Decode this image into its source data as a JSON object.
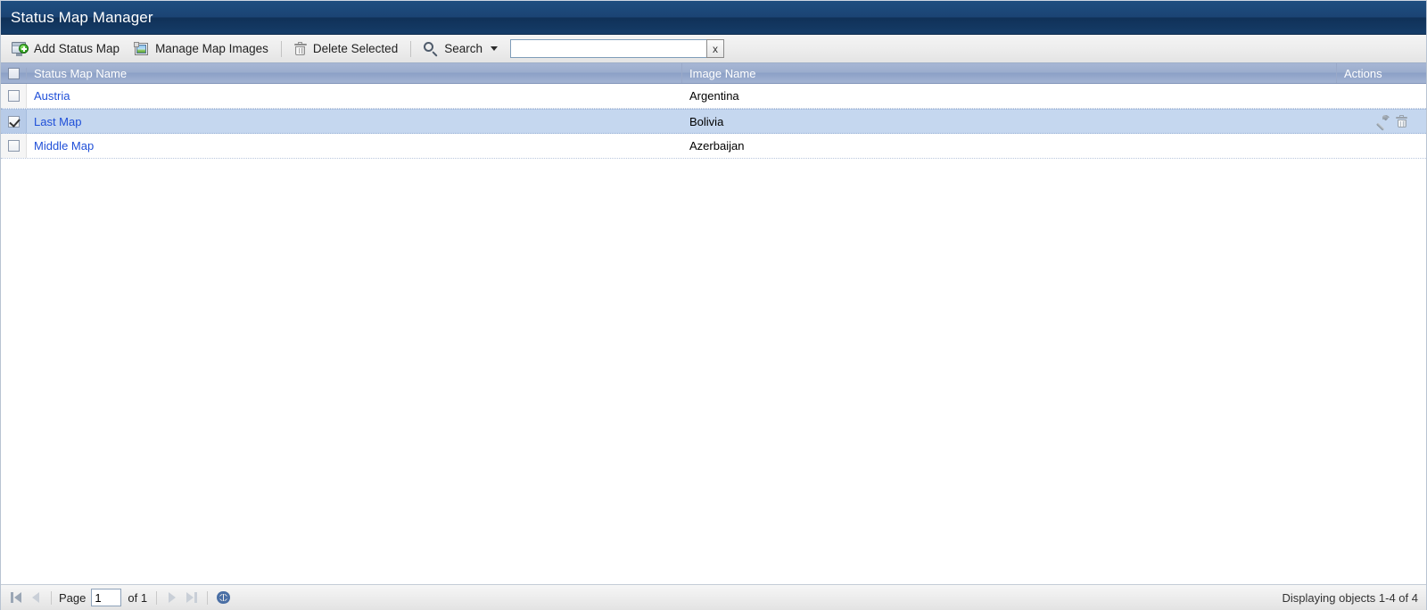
{
  "window": {
    "title": "Status Map Manager"
  },
  "toolbar": {
    "add_status_map": "Add Status Map",
    "manage_map_images": "Manage Map Images",
    "delete_selected": "Delete Selected",
    "search_label": "Search",
    "search_value": "",
    "search_placeholder": "",
    "search_clear_label": "x",
    "icons": {
      "add": "add-status-map-icon",
      "images": "manage-map-images-icon",
      "delete": "trash-icon",
      "search": "search-icon",
      "caret": "chevron-down-icon"
    }
  },
  "grid": {
    "columns": [
      {
        "key": "checkbox",
        "label": ""
      },
      {
        "key": "name",
        "label": "Status Map Name"
      },
      {
        "key": "image",
        "label": "Image Name"
      },
      {
        "key": "actions",
        "label": "Actions"
      }
    ],
    "header_checkbox_checked": false,
    "rows": [
      {
        "checked": false,
        "name": "Austria",
        "image": "Argentina",
        "selected": false,
        "show_actions": false
      },
      {
        "checked": true,
        "name": "Last Map",
        "image": "Bolivia",
        "selected": true,
        "show_actions": true
      },
      {
        "checked": false,
        "name": "Middle Map",
        "image": "Azerbaijan",
        "selected": false,
        "show_actions": false
      }
    ],
    "row_action_icons": [
      "wrench-icon",
      "trash-icon"
    ]
  },
  "statusbar": {
    "page_label": "Page",
    "page_value": "1",
    "of_label": "of 1",
    "displaying": "Displaying objects 1-4 of 4",
    "nav": {
      "first": "first-page-button",
      "prev": "previous-page-button",
      "next": "next-page-button",
      "last": "last-page-button",
      "refresh": "refresh-button"
    }
  },
  "colors": {
    "title_bar": "#1b4474",
    "grid_header": "#9badcd",
    "row_selected": "#c5d7ef",
    "link": "#1f4fd8",
    "accent_green": "#3fae2a",
    "refresh_blue": "#4a6fa5"
  }
}
